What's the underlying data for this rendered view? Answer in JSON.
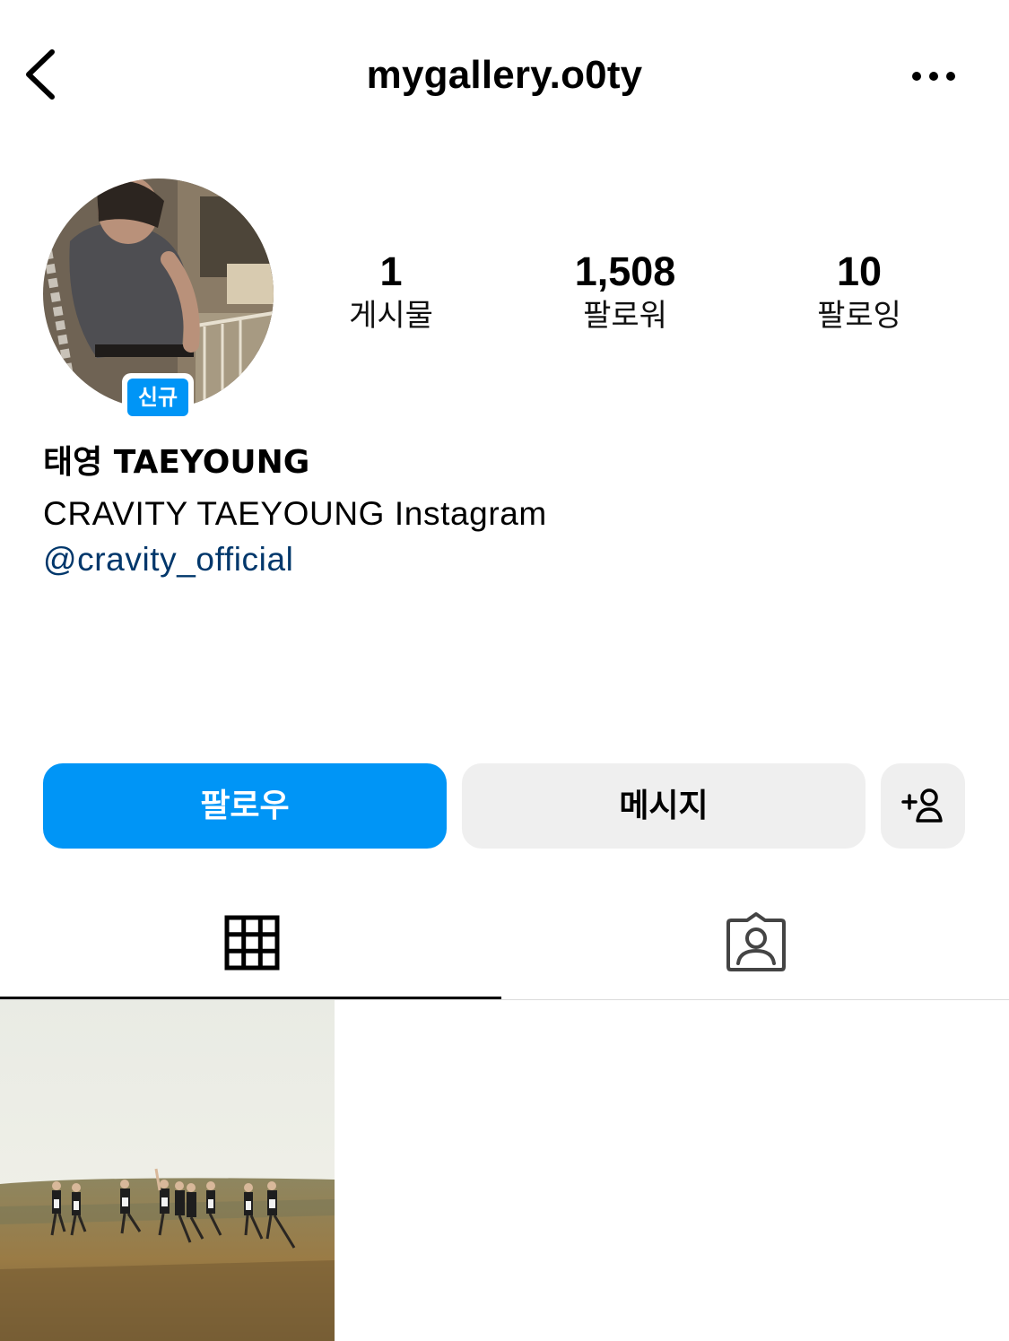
{
  "header": {
    "username": "mygallery.o0ty",
    "back_icon": "chevron-left-icon",
    "more_icon": "more-horizontal-icon"
  },
  "profile": {
    "new_badge": "신규",
    "display_name": "태영 TAEYOUNG",
    "bio": "CRAVITY TAEYOUNG Instagram",
    "mention": "@cravity_official"
  },
  "stats": {
    "posts": {
      "value": "1",
      "label": "게시물"
    },
    "followers": {
      "value": "1,508",
      "label": "팔로워"
    },
    "following": {
      "value": "10",
      "label": "팔로잉"
    }
  },
  "actions": {
    "follow_label": "팔로우",
    "message_label": "메시지",
    "suggest_icon": "add-person-icon"
  },
  "tabs": [
    {
      "name": "posts",
      "icon": "grid-icon",
      "active": true
    },
    {
      "name": "tagged",
      "icon": "tagged-person-icon",
      "active": false
    }
  ],
  "colors": {
    "accent": "#0095f6",
    "link": "#00376b",
    "secondary_button": "#efefef"
  }
}
